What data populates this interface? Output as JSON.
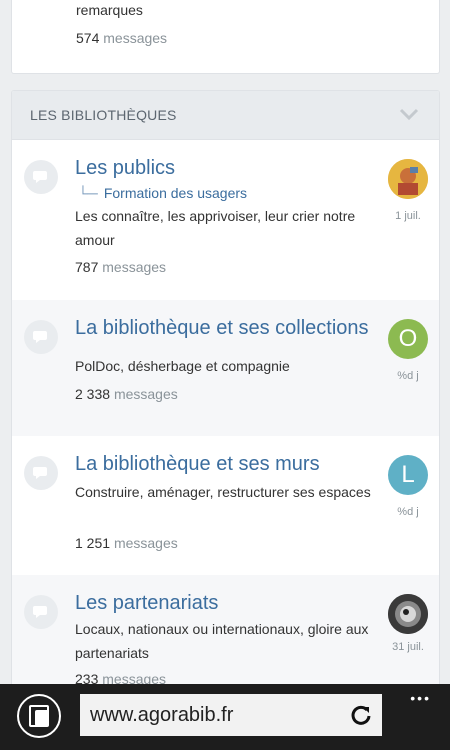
{
  "top_forum": {
    "description": "remarques",
    "count": "574",
    "count_label": "messages"
  },
  "category": {
    "title": "LES BIBLIOTHÈQUES"
  },
  "forums": [
    {
      "title": "Les publics",
      "subforum": "Formation des usagers",
      "description": "Les connaître, les apprivoiser, leur crier notre amour",
      "count": "787",
      "count_label": "messages",
      "date": "1 juil."
    },
    {
      "title": "La bibliothèque et ses collections",
      "description": "PolDoc, désherbage et compagnie",
      "count": "2 338",
      "count_label": "messages",
      "avatar_letter": "O",
      "avatar_color": "#8cba51",
      "date": "%d j"
    },
    {
      "title": "La bibliothèque et ses murs",
      "description": "Construire, aménager, restructurer ses espaces",
      "count": "1 251",
      "count_label": "messages",
      "avatar_letter": "L",
      "avatar_color": "#5fb0c6",
      "date": "%d j"
    },
    {
      "title": "Les partenariats",
      "description": "Locaux, nationaux ou internationaux, gloire aux partenariats",
      "count": "233",
      "count_label": "messages",
      "date": "31 juil."
    }
  ],
  "browser": {
    "url": "www.agorabib.fr",
    "more": "•••"
  }
}
